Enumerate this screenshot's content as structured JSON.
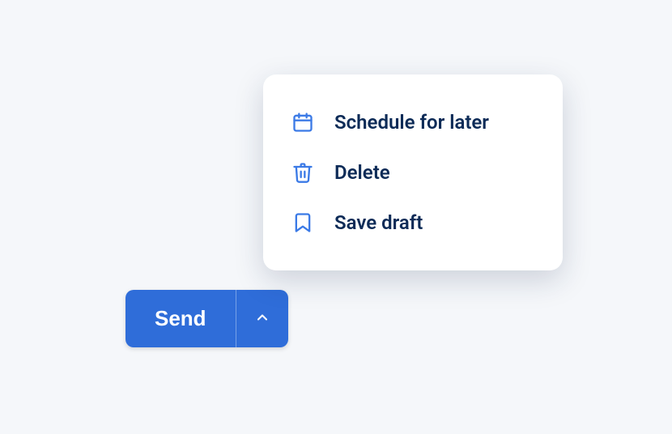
{
  "splitButton": {
    "primaryLabel": "Send"
  },
  "menu": {
    "items": [
      {
        "label": "Schedule for later"
      },
      {
        "label": "Delete"
      },
      {
        "label": "Save draft"
      }
    ]
  }
}
